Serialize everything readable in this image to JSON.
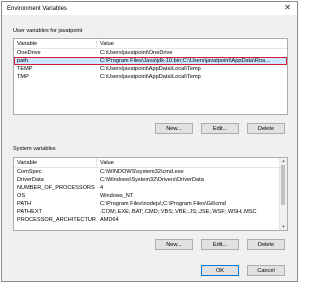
{
  "window": {
    "title": "Environment Variables",
    "close_glyph": "✕"
  },
  "user_vars": {
    "group_label": "User variables for javatpoint",
    "columns": {
      "variable": "Variable",
      "value": "Value"
    },
    "rows": [
      {
        "variable": "OneDrive",
        "value": "C:\\Users\\javatpoint\\OneDrive"
      },
      {
        "variable": "path",
        "value": "C:\\Program Files\\Java\\jdk-10.bin;C:\\Users\\javatpoint\\AppData\\Roa...",
        "selected": true
      },
      {
        "variable": "TEMP",
        "value": "C:\\Users\\javatpoint\\AppData\\Local\\Temp"
      },
      {
        "variable": "TMP",
        "value": "C:\\Users\\javatpoint\\AppData\\Local\\Temp"
      }
    ],
    "buttons": {
      "new": "New...",
      "edit": "Edit...",
      "delete": "Delete"
    }
  },
  "system_vars": {
    "group_label": "System variables",
    "columns": {
      "variable": "Variable",
      "value": "Value"
    },
    "rows": [
      {
        "variable": "ComSpec",
        "value": "C:\\WINDOWS\\system32\\cmd.exe"
      },
      {
        "variable": "DriverData",
        "value": "C:\\Windows\\System32\\Drivers\\DriverData"
      },
      {
        "variable": "NUMBER_OF_PROCESSORS",
        "value": "4"
      },
      {
        "variable": "OS",
        "value": "Windows_NT"
      },
      {
        "variable": "PATH",
        "value": "C:\\Program Files\\nodejs\\;C:\\Program Files\\Git\\cmd"
      },
      {
        "variable": "PATHEXT",
        "value": ".COM;.EXE;.BAT;.CMD;.VBS;.VBE;.JS;.JSE;.WSF;.WSH;.MSC"
      },
      {
        "variable": "PROCESSOR_ARCHITECTURE",
        "value": "AMD64"
      }
    ],
    "buttons": {
      "new": "New...",
      "edit": "Edit...",
      "delete": "Delete"
    }
  },
  "footer": {
    "ok": "OK",
    "cancel": "Cancel"
  }
}
